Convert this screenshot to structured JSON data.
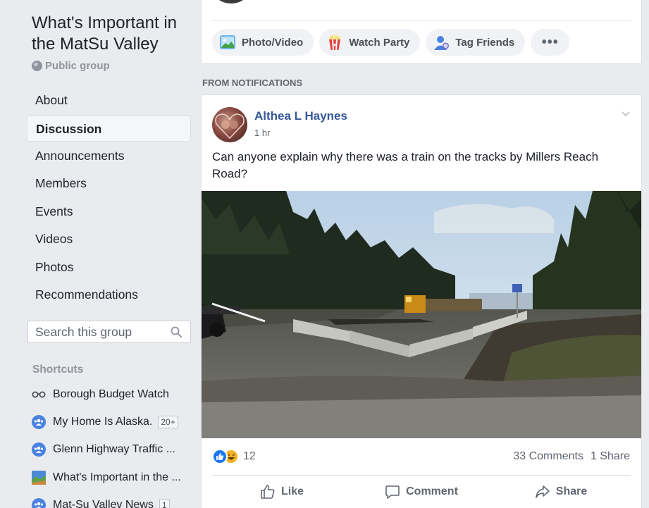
{
  "group": {
    "title": "What's Important in the MatSu Valley",
    "privacy": "Public group"
  },
  "nav": [
    {
      "label": "About",
      "active": false
    },
    {
      "label": "Discussion",
      "active": true
    },
    {
      "label": "Announcements",
      "active": false
    },
    {
      "label": "Members",
      "active": false
    },
    {
      "label": "Events",
      "active": false
    },
    {
      "label": "Videos",
      "active": false
    },
    {
      "label": "Photos",
      "active": false
    },
    {
      "label": "Recommendations",
      "active": false
    }
  ],
  "search": {
    "placeholder": "Search this group"
  },
  "shortcuts": {
    "title": "Shortcuts",
    "items": [
      {
        "label": "Borough Budget Watch",
        "icon": "glasses-icon",
        "badge": ""
      },
      {
        "label": "My Home Is Alaska.",
        "icon": "group-icon",
        "badge": "20+"
      },
      {
        "label": "Glenn Highway Traffic ...",
        "icon": "group-icon",
        "badge": ""
      },
      {
        "label": "What's Important in the ...",
        "icon": "group-photo-icon",
        "badge": ""
      },
      {
        "label": "Mat-Su Valley News",
        "icon": "group-icon",
        "badge": "1"
      }
    ]
  },
  "composer": {
    "photo_video": "Photo/Video",
    "watch_party": "Watch Party",
    "tag_friends": "Tag Friends",
    "more": "•••"
  },
  "section_label": "FROM NOTIFICATIONS",
  "post": {
    "author": "Althea L Haynes",
    "time": "1 hr",
    "text": "Can anyone explain why there was a train on the tracks by Millers Reach Road?",
    "reaction_count": "12",
    "comments": "33 Comments",
    "shares": "1 Share",
    "actions": {
      "like": "Like",
      "comment": "Comment",
      "share": "Share"
    }
  },
  "colors": {
    "link": "#385898",
    "like_blue": "#1877f2",
    "haha_yellow": "#f7b125"
  }
}
